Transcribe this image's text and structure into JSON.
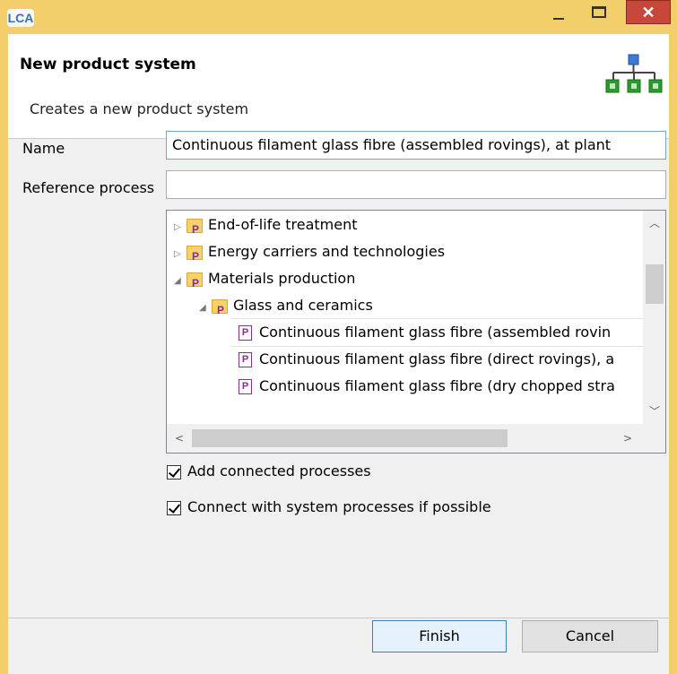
{
  "window": {
    "app_icon_label": "LCA",
    "close_glyph": "✕"
  },
  "header": {
    "title": "New product system",
    "description": "Creates a new product system",
    "icon": "product-system-tree-icon"
  },
  "form": {
    "name_label": "Name",
    "name_value": "Continuous filament glass fibre (assembled rovings), at plant",
    "reference_label": "Reference process",
    "reference_value": ""
  },
  "tree": {
    "items": [
      {
        "label": "End-of-life treatment",
        "kind": "folder",
        "expanded": false
      },
      {
        "label": "Energy carriers and technologies",
        "kind": "folder",
        "expanded": false
      },
      {
        "label": "Materials production",
        "kind": "folder",
        "expanded": true
      },
      {
        "label": "Glass and ceramics",
        "kind": "folder",
        "expanded": true
      },
      {
        "label": "Continuous filament glass fibre (assembled rovin",
        "kind": "process",
        "selected": true
      },
      {
        "label": "Continuous filament glass fibre (direct rovings), a",
        "kind": "process"
      },
      {
        "label": "Continuous filament glass fibre (dry chopped stra",
        "kind": "process"
      }
    ]
  },
  "options": {
    "add_connected": {
      "label": "Add connected processes",
      "checked": true
    },
    "connect_system": {
      "label": "Connect with system processes if possible",
      "checked": true
    }
  },
  "buttons": {
    "finish": "Finish",
    "cancel": "Cancel"
  }
}
